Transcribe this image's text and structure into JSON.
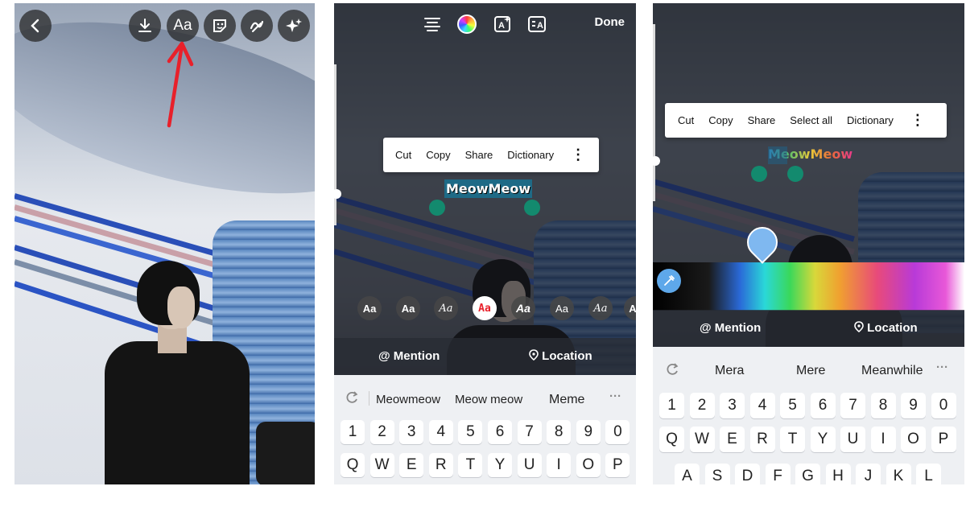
{
  "panel1": {
    "toolbar": {
      "back_icon": "chevron-left-icon",
      "download_icon": "download-icon",
      "text_label": "Aa",
      "sticker_icon": "sticker-icon",
      "draw_icon": "draw-icon",
      "effects_icon": "sparkles-icon"
    },
    "annotation_color": "#e8202a"
  },
  "panel2": {
    "top_icons": [
      "align-center-icon",
      "color-wheel-icon",
      "text-effect-icon",
      "text-animation-icon"
    ],
    "done_label": "Done",
    "context_menu": [
      "Cut",
      "Copy",
      "Share",
      "Dictionary"
    ],
    "selected_text": "MeowMeow",
    "fonts": [
      "Aa",
      "Aa",
      "Aa",
      "Aa",
      "Aa",
      "Aa",
      "Aa",
      "A"
    ],
    "mention_label": "Mention",
    "location_label": "Location",
    "suggestions": [
      "Meowmeow",
      "Meow meow",
      "Meme"
    ],
    "number_row": [
      "1",
      "2",
      "3",
      "4",
      "5",
      "6",
      "7",
      "8",
      "9",
      "0"
    ],
    "letter_row": [
      "Q",
      "W",
      "E",
      "R",
      "T",
      "Y",
      "U",
      "I",
      "O",
      "P"
    ]
  },
  "panel3": {
    "context_menu": [
      "Cut",
      "Copy",
      "Share",
      "Select all",
      "Dictionary"
    ],
    "selected_text": "MeowMeow",
    "mention_label": "Mention",
    "location_label": "Location",
    "suggestions": [
      "Mera",
      "Mere",
      "Meanwhile"
    ],
    "number_row": [
      "1",
      "2",
      "3",
      "4",
      "5",
      "6",
      "7",
      "8",
      "9",
      "0"
    ],
    "letter_row": [
      "Q",
      "W",
      "E",
      "R",
      "T",
      "Y",
      "U",
      "I",
      "O",
      "P"
    ],
    "letter_row2": [
      "A",
      "S",
      "D",
      "F",
      "G",
      "H",
      "J",
      "K",
      "L"
    ],
    "picker_color": "#7fb8f0"
  }
}
